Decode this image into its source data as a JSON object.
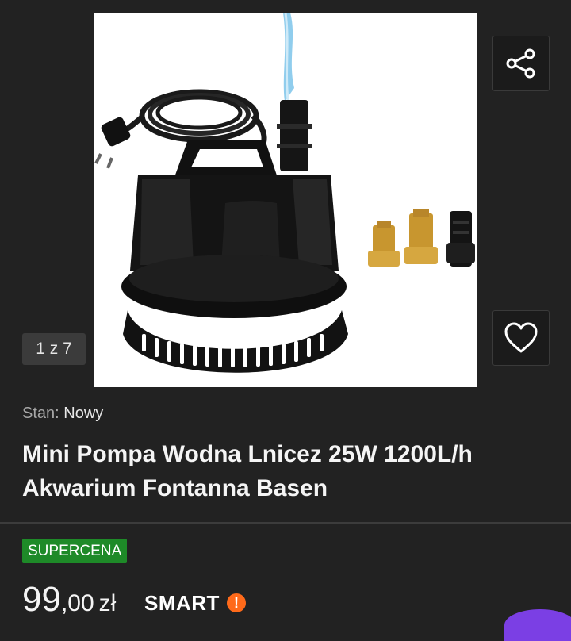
{
  "gallery": {
    "counter": "1 z 7",
    "share_icon": "share-icon",
    "favorite_icon": "heart-icon"
  },
  "product": {
    "condition_label": "Stan:",
    "condition_value": "Nowy",
    "title": "Mini Pompa Wodna Lnicez 25W 1200L/h Akwarium Fontanna Basen",
    "badge": "SUPERCENA",
    "price_integer": "99",
    "price_decimal": ",00",
    "currency": "zł",
    "smart_label": "SMART",
    "smart_mark": "!"
  },
  "colors": {
    "background": "#222222",
    "badge": "#1e8a28",
    "smart_accent": "#ff6a1a"
  }
}
